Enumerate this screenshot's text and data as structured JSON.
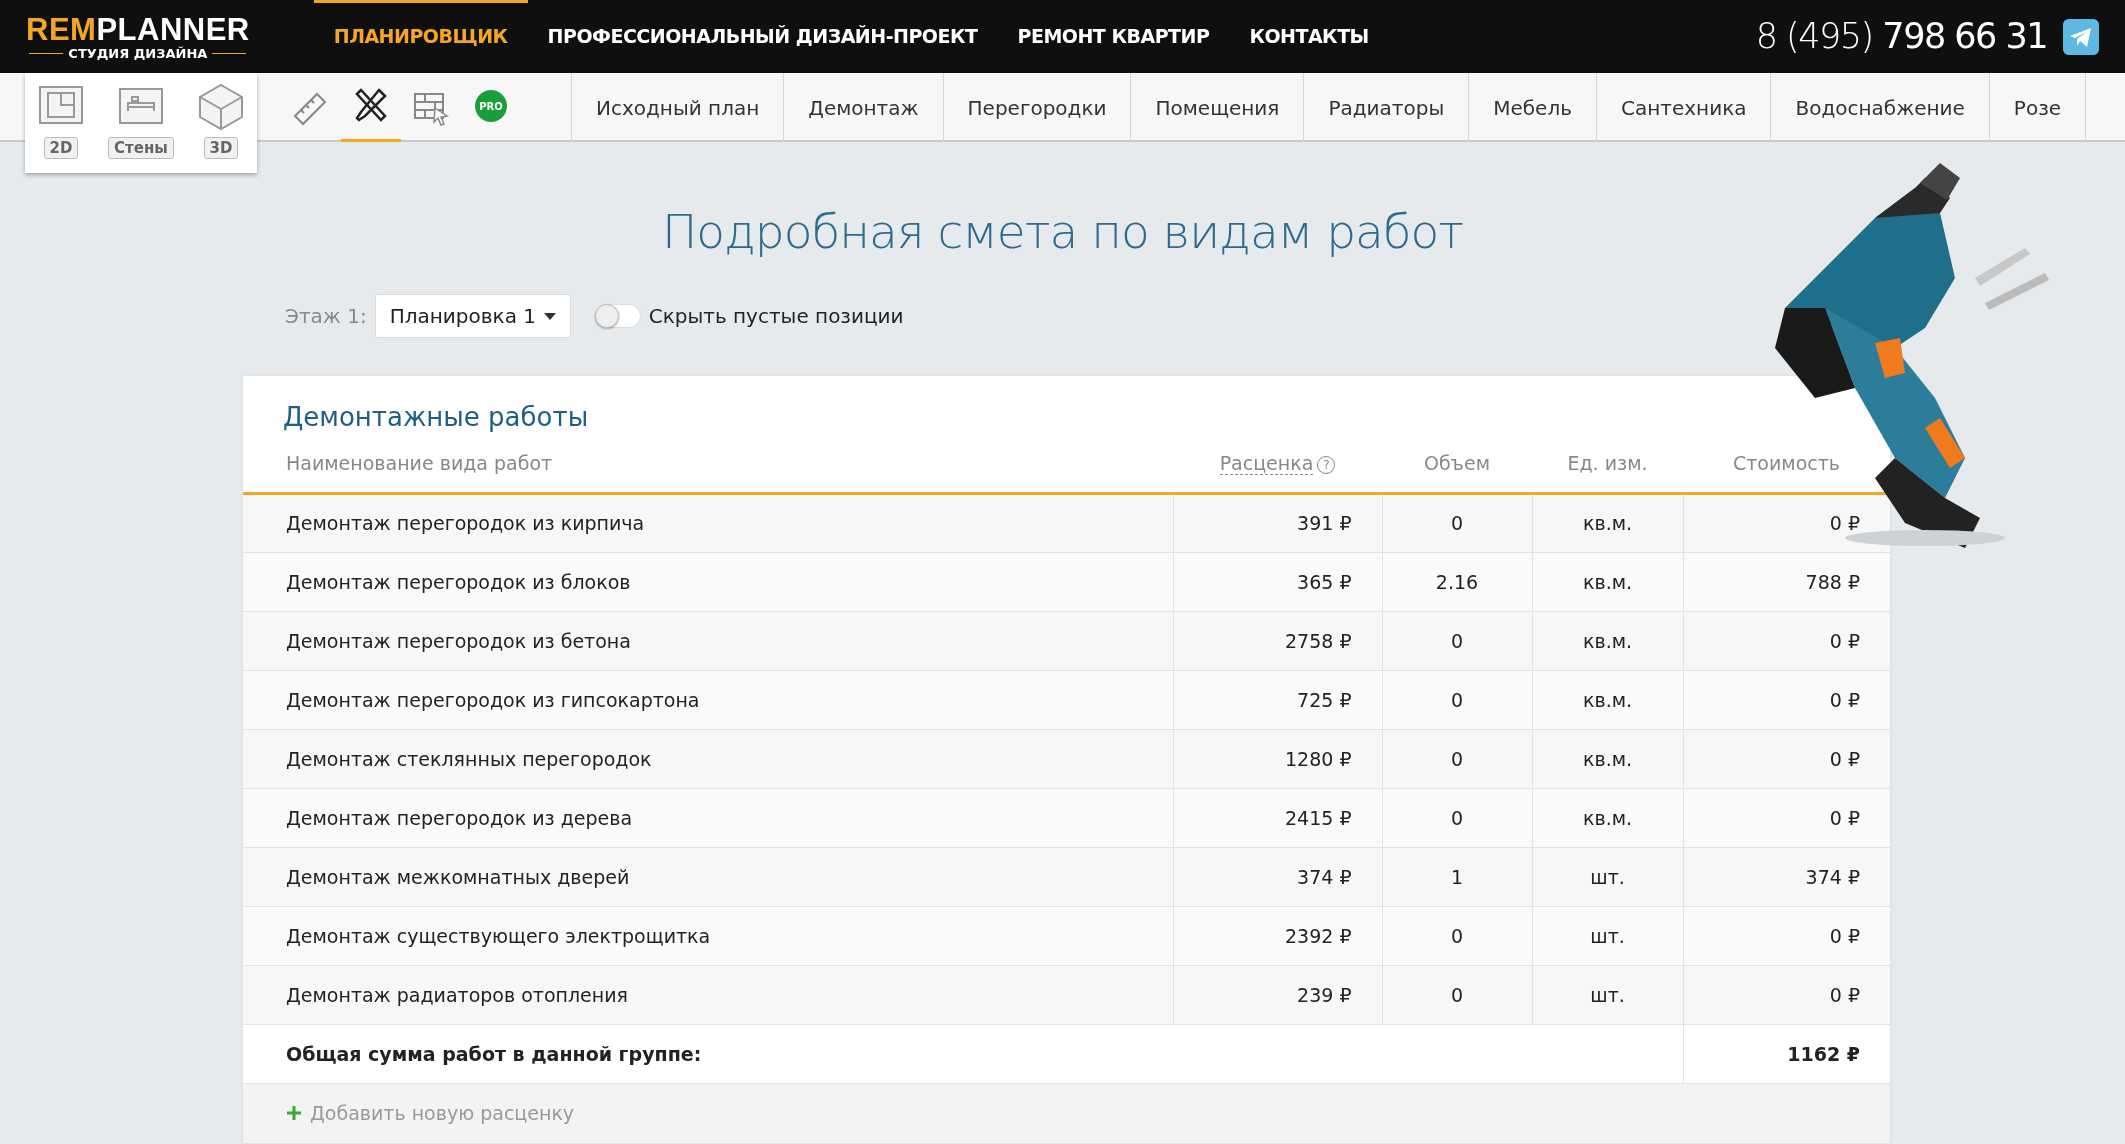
{
  "logo": {
    "brand_accent": "REM",
    "brand": "PLANNER",
    "subtitle": "СТУДИЯ ДИЗАЙНА"
  },
  "top_nav": [
    {
      "label": "ПЛАНИРОВЩИК",
      "selected": true
    },
    {
      "label": "ПРОФЕССИОНАЛЬНЫЙ ДИЗАЙН-ПРОЕКТ",
      "selected": false
    },
    {
      "label": "РЕМОНТ КВАРТИР",
      "selected": false
    },
    {
      "label": "КОНТАКТЫ",
      "selected": false
    }
  ],
  "phone": {
    "prefix": "8 (495)",
    "number": "798 66 31"
  },
  "view_modes": [
    {
      "kind": "plan",
      "label": "2D"
    },
    {
      "kind": "walls",
      "label": "Стены"
    },
    {
      "kind": "room3d",
      "label": "3D"
    }
  ],
  "tools": [
    {
      "kind": "ruler",
      "selected": false
    },
    {
      "kind": "tools",
      "selected": true
    },
    {
      "kind": "bricks",
      "selected": false
    },
    {
      "kind": "pro",
      "label": "PRO",
      "selected": false
    }
  ],
  "tabs": [
    {
      "label": "Исходный план",
      "selected": false
    },
    {
      "label": "Демонтаж",
      "selected": false
    },
    {
      "label": "Перегородки",
      "selected": false
    },
    {
      "label": "Помещения",
      "selected": false
    },
    {
      "label": "Радиаторы",
      "selected": false
    },
    {
      "label": "Мебель",
      "selected": false
    },
    {
      "label": "Сантехника",
      "selected": false
    },
    {
      "label": "Водоснабжение",
      "selected": false
    },
    {
      "label": "Розе",
      "selected": false
    }
  ],
  "title": "Подробная смета по видам работ",
  "filters": {
    "floor_label": "Этаж 1:",
    "layout_select": "Планировка 1",
    "hide_empty": {
      "label": "Скрыть пустые позиции",
      "on": false
    }
  },
  "section": {
    "title": "Демонтажные работы",
    "columns": [
      "Наименование вида работ",
      "Расценка",
      "Объем",
      "Ед. изм.",
      "Стоимость"
    ],
    "rate_help": "?",
    "rows": [
      {
        "name": "Демонтаж перегородок из кирпича",
        "rate": "391 ₽",
        "volume": "0",
        "unit": "кв.м.",
        "cost": "0 ₽"
      },
      {
        "name": "Демонтаж перегородок из блоков",
        "rate": "365 ₽",
        "volume": "2.16",
        "unit": "кв.м.",
        "cost": "788 ₽"
      },
      {
        "name": "Демонтаж перегородок из бетона",
        "rate": "2758 ₽",
        "volume": "0",
        "unit": "кв.м.",
        "cost": "0 ₽"
      },
      {
        "name": "Демонтаж перегородок из гипсокартона",
        "rate": "725 ₽",
        "volume": "0",
        "unit": "кв.м.",
        "cost": "0 ₽"
      },
      {
        "name": "Демонтаж стеклянных перегородок",
        "rate": "1280 ₽",
        "volume": "0",
        "unit": "кв.м.",
        "cost": "0 ₽"
      },
      {
        "name": "Демонтаж перегородок из дерева",
        "rate": "2415 ₽",
        "volume": "0",
        "unit": "кв.м.",
        "cost": "0 ₽"
      },
      {
        "name": "Демонтаж межкомнатных дверей",
        "rate": "374 ₽",
        "volume": "1",
        "unit": "шт.",
        "cost": "374 ₽"
      },
      {
        "name": "Демонтаж существующего электрощитка",
        "rate": "2392 ₽",
        "volume": "0",
        "unit": "шт.",
        "cost": "0 ₽"
      },
      {
        "name": "Демонтаж радиаторов отопления",
        "rate": "239 ₽",
        "volume": "0",
        "unit": "шт.",
        "cost": "0 ₽"
      }
    ],
    "total": {
      "label": "Общая сумма работ в данной группе:",
      "value": "1162 ₽"
    },
    "add_link": "Добавить новую расценку"
  }
}
